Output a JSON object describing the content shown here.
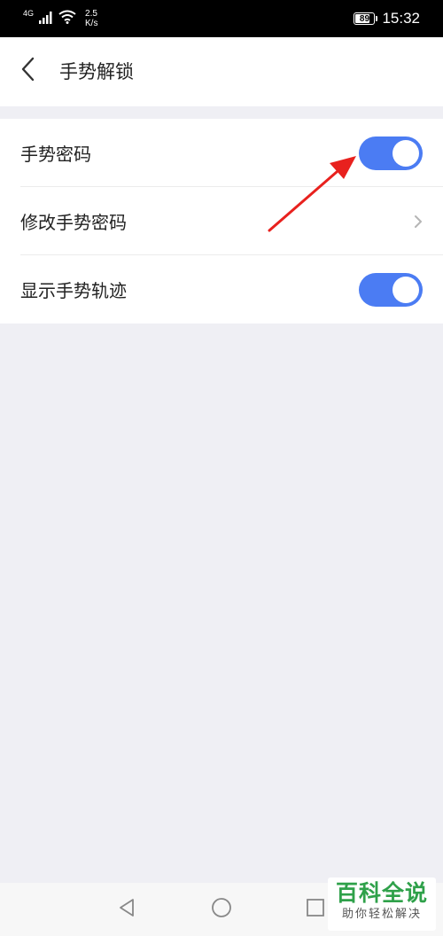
{
  "status_bar": {
    "network_type": "4G",
    "speed_value": "2.5",
    "speed_unit": "K/s",
    "battery_level": "89",
    "battery_fraction": 0.89,
    "time": "15:32",
    "icons": [
      "signal-icon",
      "wifi-icon",
      "battery-icon"
    ]
  },
  "header": {
    "back_icon": "back-arrow-icon",
    "title": "手势解锁"
  },
  "settings": {
    "items": [
      {
        "label": "手势密码",
        "control": "toggle",
        "on": true
      },
      {
        "label": "修改手势密码",
        "control": "chevron"
      },
      {
        "label": "显示手势轨迹",
        "control": "toggle",
        "on": true
      }
    ]
  },
  "nav_bar": {
    "buttons": [
      "back-triangle-icon",
      "home-circle-icon",
      "recents-square-icon"
    ]
  },
  "watermark": {
    "main": "百科全说",
    "sub": "助你轻松解决"
  },
  "colors": {
    "accent": "#4b7cf3",
    "background": "#efeff4",
    "annotation": "#e8211e",
    "watermark_green": "#2fa14a"
  }
}
